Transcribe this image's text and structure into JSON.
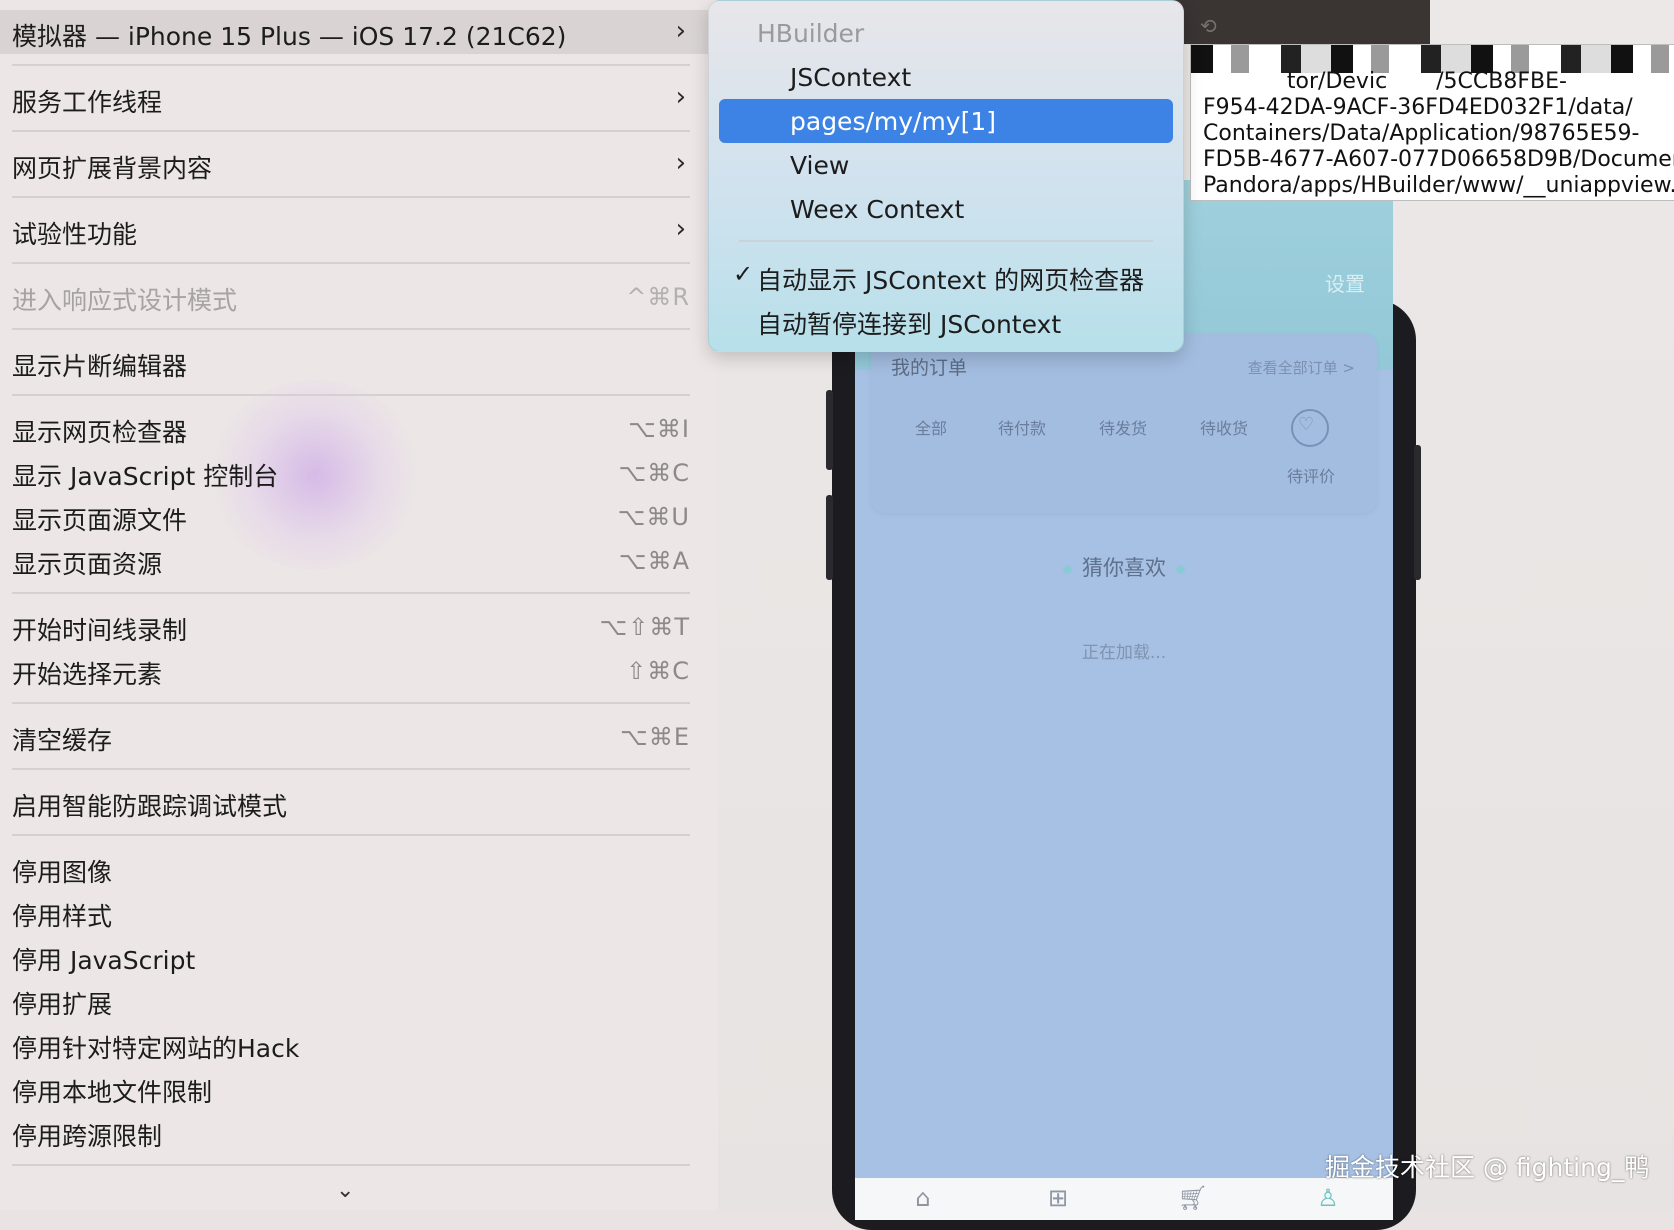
{
  "main_menu": {
    "items": [
      {
        "label": "模拟器 — iPhone 15 Plus — iOS 17.2 (21C62)",
        "submenu": true
      },
      {
        "label": "服务工作线程",
        "submenu": true
      },
      {
        "label": "网页扩展背景内容",
        "submenu": true
      },
      {
        "label": "试验性功能",
        "submenu": true
      },
      {
        "label": "进入响应式设计模式",
        "shortcut": "^⌘R",
        "disabled": true
      },
      {
        "label": "显示片断编辑器"
      },
      {
        "label": "显示网页检查器",
        "shortcut": "⌥⌘I"
      },
      {
        "label": "显示 JavaScript 控制台",
        "shortcut": "⌥⌘C"
      },
      {
        "label": "显示页面源文件",
        "shortcut": "⌥⌘U"
      },
      {
        "label": "显示页面资源",
        "shortcut": "⌥⌘A"
      },
      {
        "label": "开始时间线录制",
        "shortcut": "⌥⇧⌘T"
      },
      {
        "label": "开始选择元素",
        "shortcut": "⇧⌘C"
      },
      {
        "label": "清空缓存",
        "shortcut": "⌥⌘E"
      },
      {
        "label": "启用智能防跟踪调试模式"
      },
      {
        "label": "停用图像"
      },
      {
        "label": "停用样式"
      },
      {
        "label": "停用 JavaScript"
      },
      {
        "label": "停用扩展"
      },
      {
        "label": "停用针对特定网站的Hack"
      },
      {
        "label": "停用本地文件限制"
      },
      {
        "label": "停用跨源限制"
      }
    ],
    "chevron": "›",
    "more_arrow": "⌄"
  },
  "submenu": {
    "header": "HBuilder",
    "items": [
      {
        "label": "JSContext"
      },
      {
        "label": "pages/my/my[1]",
        "selected": true
      },
      {
        "label": "View"
      },
      {
        "label": "Weex Context"
      }
    ],
    "options": [
      {
        "label": "自动显示 JSContext 的网页检查器",
        "checked": true,
        "check_glyph": "✓"
      },
      {
        "label": "自动暂停连接到 JSContext",
        "checked": false
      }
    ]
  },
  "tooltip": {
    "text": "            tor/Devic       /5CCB8FBE-\nF954-42DA-9ACF-36FD4ED032F1/data/\nContainers/Data/Application/98765E59-\nFD5B-4677-A607-077D06658D9B/Documen\nPandora/apps/HBuilder/www/__uniappview.ht"
  },
  "simulator": {
    "settings_label": "设置",
    "order": {
      "title": "我的订单",
      "view_all": "查看全部订单 >",
      "tabs": [
        "全部",
        "待付款",
        "待发货",
        "待收货"
      ],
      "review": "待评价",
      "review_icon": "heart-outline-icon"
    },
    "guess_title": "猜你喜欢",
    "loading": "正在加载...",
    "tabbar_icons": [
      "home-icon",
      "category-icon",
      "cart-icon",
      "user-icon"
    ]
  },
  "watermark": "掘金技术社区 @ fighting_鸭",
  "colors": {
    "menu_bg": "#ece7e6",
    "selection": "#3d83e6",
    "screen_bg": "#a7c1e4",
    "screen_header": "#9fd0dc"
  }
}
